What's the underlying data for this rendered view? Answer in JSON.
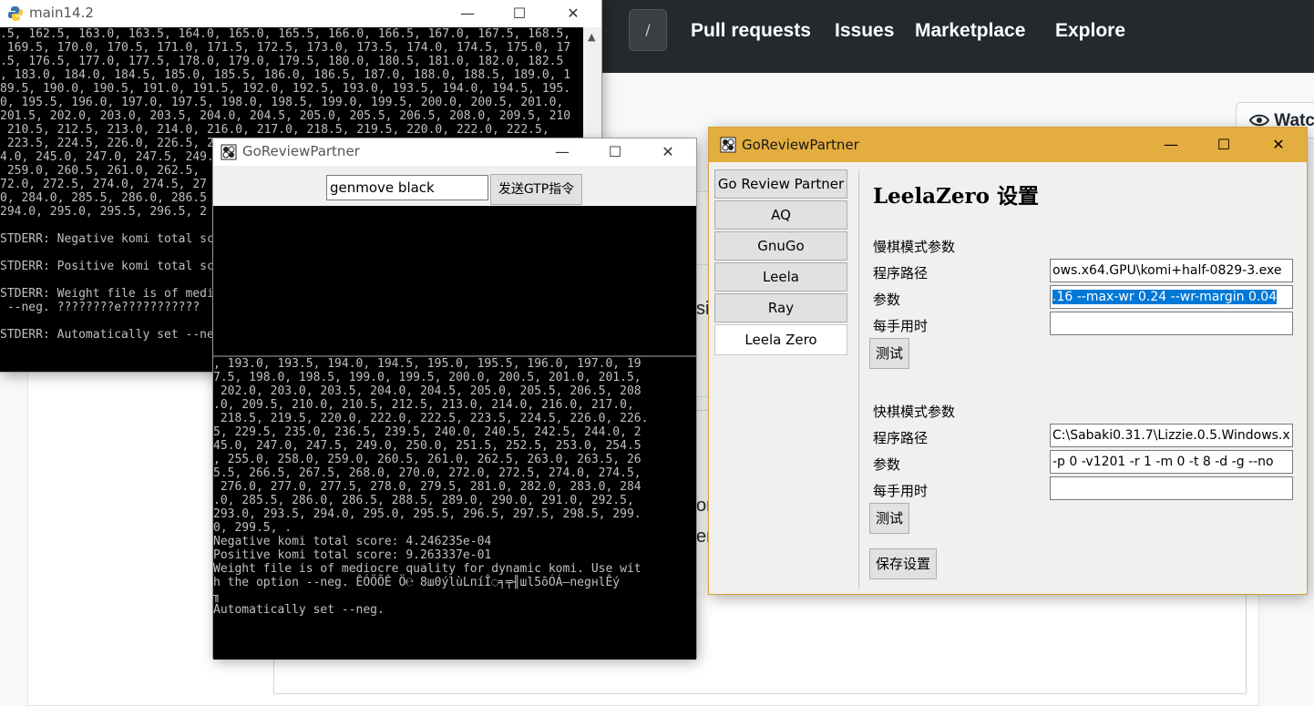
{
  "github": {
    "slash_key": "/",
    "nav": [
      "Pull requests",
      "Issues",
      "Marketplace",
      "Explore"
    ],
    "watch_label": "Watc",
    "fragments": [
      "si",
      "on",
      "er"
    ]
  },
  "console_window": {
    "title": "main14.2",
    "lines": [
      ".5, 162.5, 163.0, 163.5, 164.0, 165.0, 165.5, 166.0, 166.5, 167.0, 167.5, 168.5,",
      " 169.5, 170.0, 170.5, 171.0, 171.5, 172.5, 173.0, 173.5, 174.0, 174.5, 175.0, 17",
      ".5, 176.5, 177.0, 177.5, 178.0, 179.0, 179.5, 180.0, 180.5, 181.0, 182.0, 182.5",
      ", 183.0, 184.0, 184.5, 185.0, 185.5, 186.0, 186.5, 187.0, 188.0, 188.5, 189.0, 1",
      "89.5, 190.0, 190.5, 191.0, 191.5, 192.0, 192.5, 193.0, 193.5, 194.0, 194.5, 195.",
      "0, 195.5, 196.0, 197.0, 197.5, 198.0, 198.5, 199.0, 199.5, 200.0, 200.5, 201.0,",
      "201.5, 202.0, 203.0, 203.5, 204.0, 204.5, 205.0, 205.5, 206.5, 208.0, 209.5, 210",
      " 210.5, 212.5, 213.0, 214.0, 216.0, 217.0, 218.5, 219.5, 220.0, 222.0, 222.5,",
      " 223.5, 224.5, 226.0, 226.5, 2",
      "4.0, 245.0, 247.0, 247.5, 249.",
      " 259.0, 260.5, 261.0, 262.5,",
      "72.0, 272.5, 274.0, 274.5, 27",
      "0, 284.0, 285.5, 286.0, 286.5",
      "294.0, 295.0, 295.5, 296.5, 2",
      "",
      "STDERR: Negative komi total sc",
      "",
      "STDERR: Positive komi total sc",
      "",
      "STDERR: Weight file is of medi",
      " --neg. ????????e???????????",
      "",
      "STDERR: Automatically set --ne"
    ]
  },
  "gtp_window": {
    "title": "GoReviewPartner",
    "input_value": "genmove black",
    "send_button": "发送GTP指令",
    "lines": [
      ", 193.0, 193.5, 194.0, 194.5, 195.0, 195.5, 196.0, 197.0, 19",
      "7.5, 198.0, 198.5, 199.0, 199.5, 200.0, 200.5, 201.0, 201.5,",
      " 202.0, 203.0, 203.5, 204.0, 204.5, 205.0, 205.5, 206.5, 208",
      ".0, 209.5, 210.0, 210.5, 212.5, 213.0, 214.0, 216.0, 217.0,",
      " 218.5, 219.5, 220.0, 222.0, 222.5, 223.5, 224.5, 226.0, 226.",
      "5, 229.5, 235.0, 236.5, 239.5, 240.0, 240.5, 242.5, 244.0, 2",
      "45.0, 247.0, 247.5, 249.0, 250.0, 251.5, 252.5, 253.0, 254.5",
      ", 255.0, 258.0, 259.0, 260.5, 261.0, 262.5, 263.0, 263.5, 26",
      "5.5, 266.5, 267.5, 268.0, 270.0, 272.0, 272.5, 274.0, 274.5,",
      " 276.0, 277.0, 277.5, 278.0, 279.5, 281.0, 282.0, 283.0, 284",
      ".0, 285.5, 286.0, 286.5, 288.5, 289.0, 290.0, 291.0, 292.5,",
      "293.0, 293.5, 294.0, 295.0, 295.5, 296.5, 297.5, 298.5, 299.",
      "0, 299.5, .",
      "Negative komi total score: 4.246235e-04",
      "Positive komi total score: 9.263337e-01",
      "Weight file is of mediocre quality for dynamic komi. Use wit",
      "h the option --neg. ÊÓÖÕÊ Ö℮ 8ш0ýlùLпíÎ◌╕╤╢шl5ōÓÁ—negнlÊý",
      "╖",
      "Automatically set --neg."
    ]
  },
  "settings_window": {
    "title": "GoReviewPartner",
    "sidebar": [
      "Go Review Partner",
      "AQ",
      "GnuGo",
      "Leela",
      "Ray",
      "Leela Zero"
    ],
    "active_tab": "Leela Zero",
    "heading": "LeelaZero 设置",
    "slow": {
      "section": "慢棋模式参数",
      "path_label": "程序路径",
      "path_value": "ows.x64.GPU\\komi+half-0829-3.exe",
      "params_label": "参数",
      "params_value": ".16 --max-wr 0.24 --wr-margin 0.04",
      "time_label": "每手用时",
      "time_value": "",
      "test_button": "测试"
    },
    "fast": {
      "section": "快棋模式参数",
      "path_label": "程序路径",
      "path_value": "C:\\Sabaki0.31.7\\Lizzie.0.5.Windows.x",
      "params_label": "参数",
      "params_value": "-p 0 -v1201 -r 1 -m 0 -t 8 -d -g --no",
      "time_label": "每手用时",
      "time_value": "",
      "test_button": "测试"
    },
    "save_button": "保存设置"
  },
  "window_controls": {
    "minimize": "—",
    "maximize": "☐",
    "close": "✕"
  }
}
